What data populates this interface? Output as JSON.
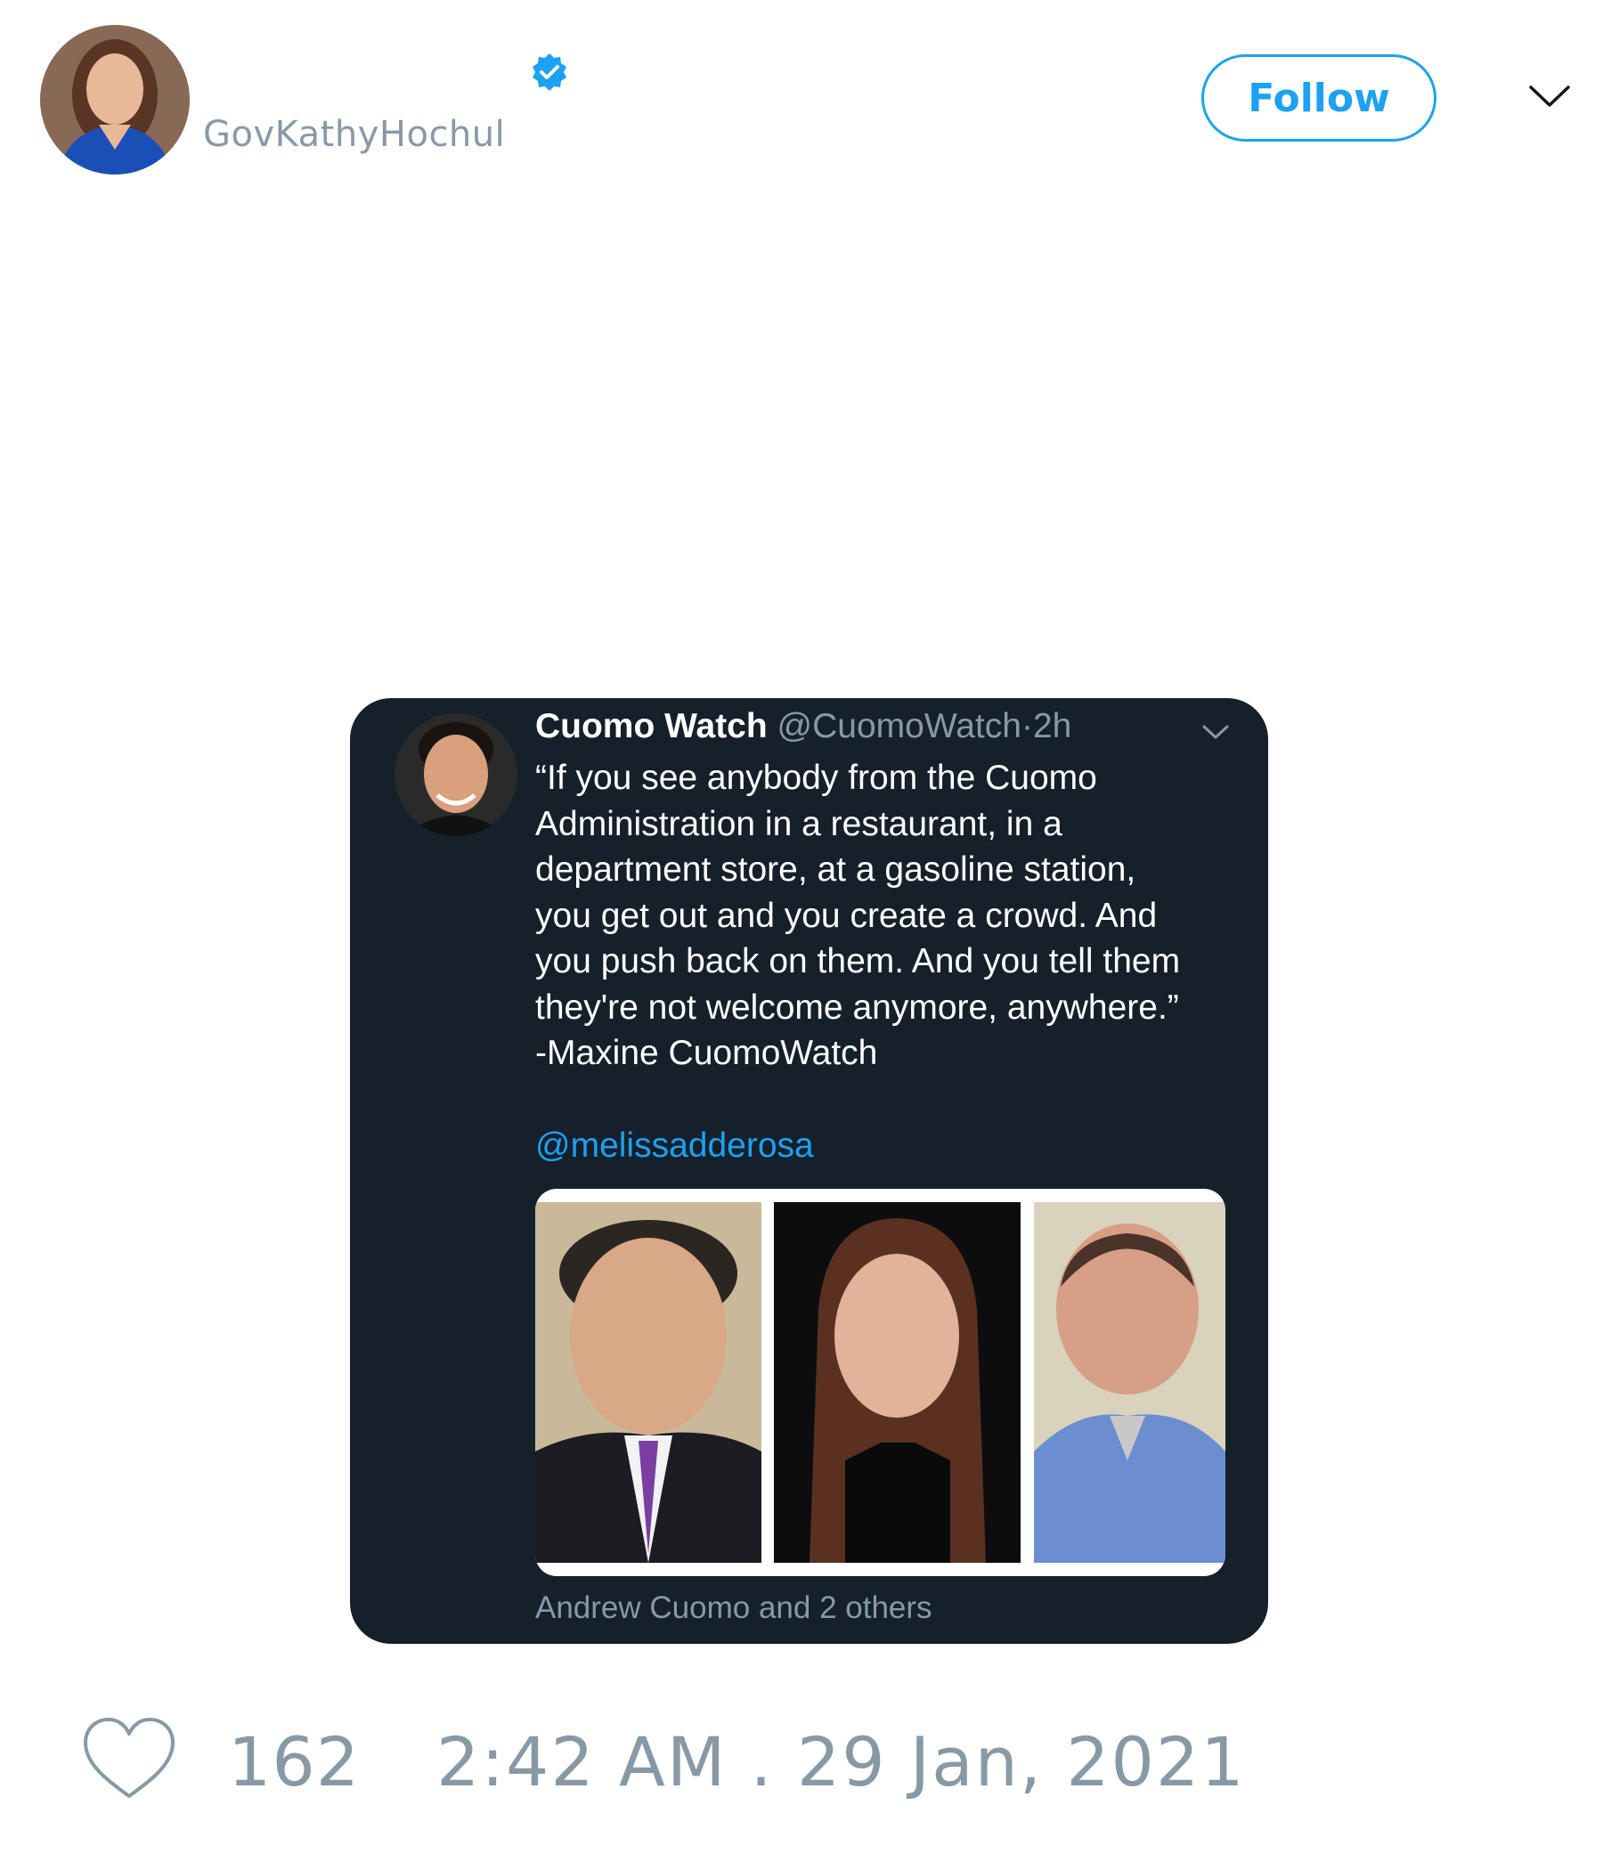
{
  "header": {
    "handle": "GovKathyHochul",
    "follow_label": "Follow",
    "avatar_icon": "profile-photo",
    "verified_icon": "verified-badge-icon",
    "menu_icon": "chevron-down-icon",
    "accent_color": "#1da1f2"
  },
  "embedded_tweet": {
    "background": "#15202b",
    "display_name": "Cuomo Watch",
    "handle": "@CuomoWatch",
    "separator": "·",
    "time": "2h",
    "text": "“If you see anybody from the Cuomo\nAdministration in a restaurant, in a\ndepartment store, at a gasoline station,\nyou get out and you create a crowd. And\nyou push back on them. And you tell them\nthey're not welcome anymore, anywhere.”\n-Maxine CuomoWatch",
    "mention": "@melissadderosa",
    "tagged": "Andrew Cuomo and 2 others",
    "media_count": 3
  },
  "footer": {
    "like_icon": "heart-icon",
    "like_count": "162",
    "timestamp": "2:42 AM . 29 Jan, 2021",
    "muted_color": "#8899a6"
  }
}
